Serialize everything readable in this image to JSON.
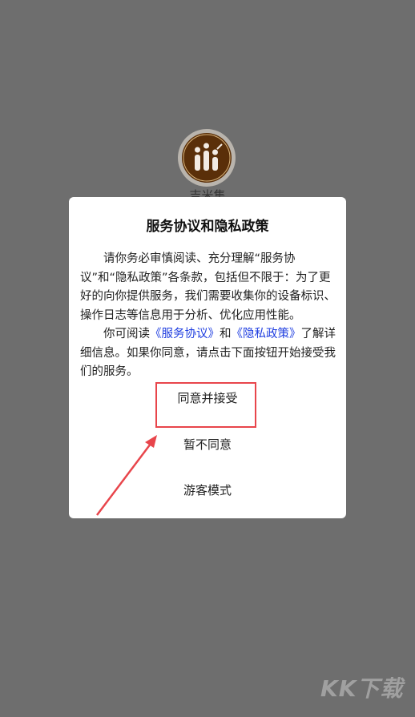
{
  "app": {
    "name": "吉米集"
  },
  "dialog": {
    "title": "服务协议和隐私政策",
    "paragraph1": "请你务必审慎阅读、充分理解“服务协议”和“隐私政策”各条款，包括但不限于：为了更好的向你提供服务，我们需要收集你的设备标识、操作日志等信息用于分析、优化应用性能。",
    "p2_prefix": "你可阅读",
    "service_link": "《服务协议》",
    "p2_and": "和",
    "privacy_link": "《隐私政策》",
    "p2_suffix": "了解详细信息。如果你同意，请点击下面按钮开始接受我们的服务。",
    "accept_label": "同意并接受",
    "decline_label": "暂不同意",
    "guest_label": "游客模式"
  },
  "colors": {
    "overlay": "#6e6e6e",
    "link": "#1f3ee0",
    "highlight": "#e8454b"
  },
  "watermark": {
    "text": "KK下载"
  }
}
